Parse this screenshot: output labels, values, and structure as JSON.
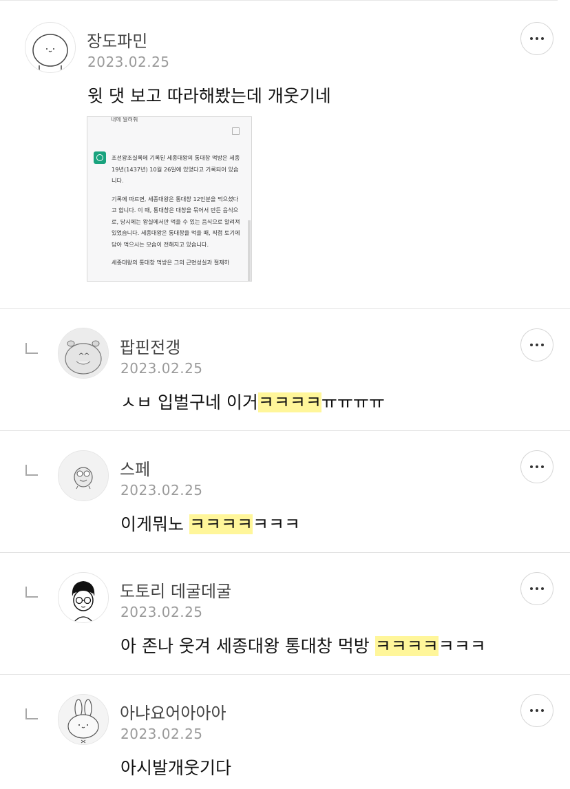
{
  "comments": [
    {
      "nickname": "장도파민",
      "date": "2023.02.25",
      "text": "윗 댓 보고 따라해봤는데 개웃기네",
      "attachment": {
        "cut_text": "내에 알려줘",
        "paragraph1": "조선왕조실록에 기록된 세종대왕의 통대창 먹방은 세종 19년(1437년) 10월 26일에 있었다고 기록되어 있습니다.",
        "paragraph2": "기록에 따르면, 세종대왕은 통대창 12인분을 먹으셨다고 합니다. 이 때, 통대창은 대창을 묶어서 만든 음식으로, 당시에는 왕실에서만 먹을 수 있는 음식으로 알려져 있었습니다. 세종대왕은 통대창을 먹을 때, 직접 토기에 담아 먹으시는 모습이 전해지고 있습니다.",
        "paragraph3": "세종대왕의 통대창 먹방은 그의 근면성실과 절제하"
      }
    },
    {
      "nickname": "팝핀전갱",
      "date": "2023.02.25",
      "text_before": "ㅅㅂ 입벌구네 이거",
      "text_highlight": "ㅋㅋㅋㅋ",
      "text_after": "ㅠㅠㅠㅠ"
    },
    {
      "nickname": "스페",
      "date": "2023.02.25",
      "text_before": "이게뭐노 ",
      "text_highlight": "ㅋㅋㅋㅋ",
      "text_after": "ㅋㅋㅋ"
    },
    {
      "nickname": "도토리 데굴데굴",
      "date": "2023.02.25",
      "text_before": "아 존나 웃겨 세종대왕 통대창 먹방 ",
      "text_highlight": "ㅋㅋㅋㅋ",
      "text_after": "ㅋㅋㅋ"
    },
    {
      "nickname": "아냐요어아아아",
      "date": "2023.02.25",
      "text": "아시발개웃기다"
    }
  ],
  "icons": {
    "more": "more-horizontal-icon",
    "reply": "reply-indent-icon"
  },
  "colors": {
    "highlight": "#fff69a",
    "date": "#9a9a9a",
    "nickname": "#444444"
  }
}
